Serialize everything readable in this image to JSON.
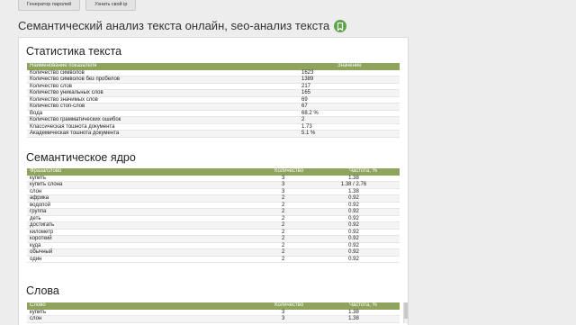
{
  "topbar": {
    "buttons": [
      "Генератор паролей",
      "Узнать свой ip"
    ]
  },
  "title": "Семантический анализ текста онлайн, seo-анализ текста",
  "stats": {
    "heading": "Статистика текста",
    "col_name": "Наименование показателя",
    "col_value": "Значение",
    "rows": [
      {
        "name": "Количество символов",
        "value": "1623"
      },
      {
        "name": "Количество символов без пробелов",
        "value": "1389"
      },
      {
        "name": "Количество слов",
        "value": "217"
      },
      {
        "name": "Количество уникальных слов",
        "value": "165"
      },
      {
        "name": "Количество значимых слов",
        "value": "69"
      },
      {
        "name": "Количество стоп-слов",
        "value": "67"
      },
      {
        "name": "Вода",
        "value": "68.2 %"
      },
      {
        "name": "Количество грамматических ошибок",
        "value": "2"
      },
      {
        "name": "Классическая тошнота документа",
        "value": "1.73"
      },
      {
        "name": "Академическая тошнота документа",
        "value": "5.1 %"
      }
    ]
  },
  "core": {
    "heading": "Семантическое ядро",
    "col_phrase": "Фраза/слово",
    "col_count": "Количество",
    "col_freq": "Частота, %",
    "rows": [
      {
        "phrase": "купить",
        "count": "3",
        "freq": "1.38"
      },
      {
        "phrase": "купить слона",
        "count": "3",
        "freq": "1.38 / 2.76"
      },
      {
        "phrase": "слон",
        "count": "3",
        "freq": "1.38"
      },
      {
        "phrase": "африка",
        "count": "2",
        "freq": "0.92"
      },
      {
        "phrase": "водопой",
        "count": "2",
        "freq": "0.92"
      },
      {
        "phrase": "группа",
        "count": "2",
        "freq": "0.92"
      },
      {
        "phrase": "деть",
        "count": "2",
        "freq": "0.92"
      },
      {
        "phrase": "достигать",
        "count": "2",
        "freq": "0.92"
      },
      {
        "phrase": "километр",
        "count": "2",
        "freq": "0.92"
      },
      {
        "phrase": "короткий",
        "count": "2",
        "freq": "0.92"
      },
      {
        "phrase": "куда",
        "count": "2",
        "freq": "0.92"
      },
      {
        "phrase": "обычный",
        "count": "2",
        "freq": "0.92"
      },
      {
        "phrase": "один",
        "count": "2",
        "freq": "0.92"
      }
    ]
  },
  "words": {
    "heading": "Слова",
    "col_word": "Слово",
    "col_count": "Количество",
    "col_freq": "Частота, %",
    "rows": [
      {
        "word": "купить",
        "count": "3",
        "freq": "1.38"
      },
      {
        "word": "слон",
        "count": "3",
        "freq": "1.38"
      }
    ]
  },
  "colors": {
    "header": "#8ea35c",
    "bookmark": "#5fa34a"
  },
  "icons": {
    "bookmark": "bookmark-icon"
  }
}
